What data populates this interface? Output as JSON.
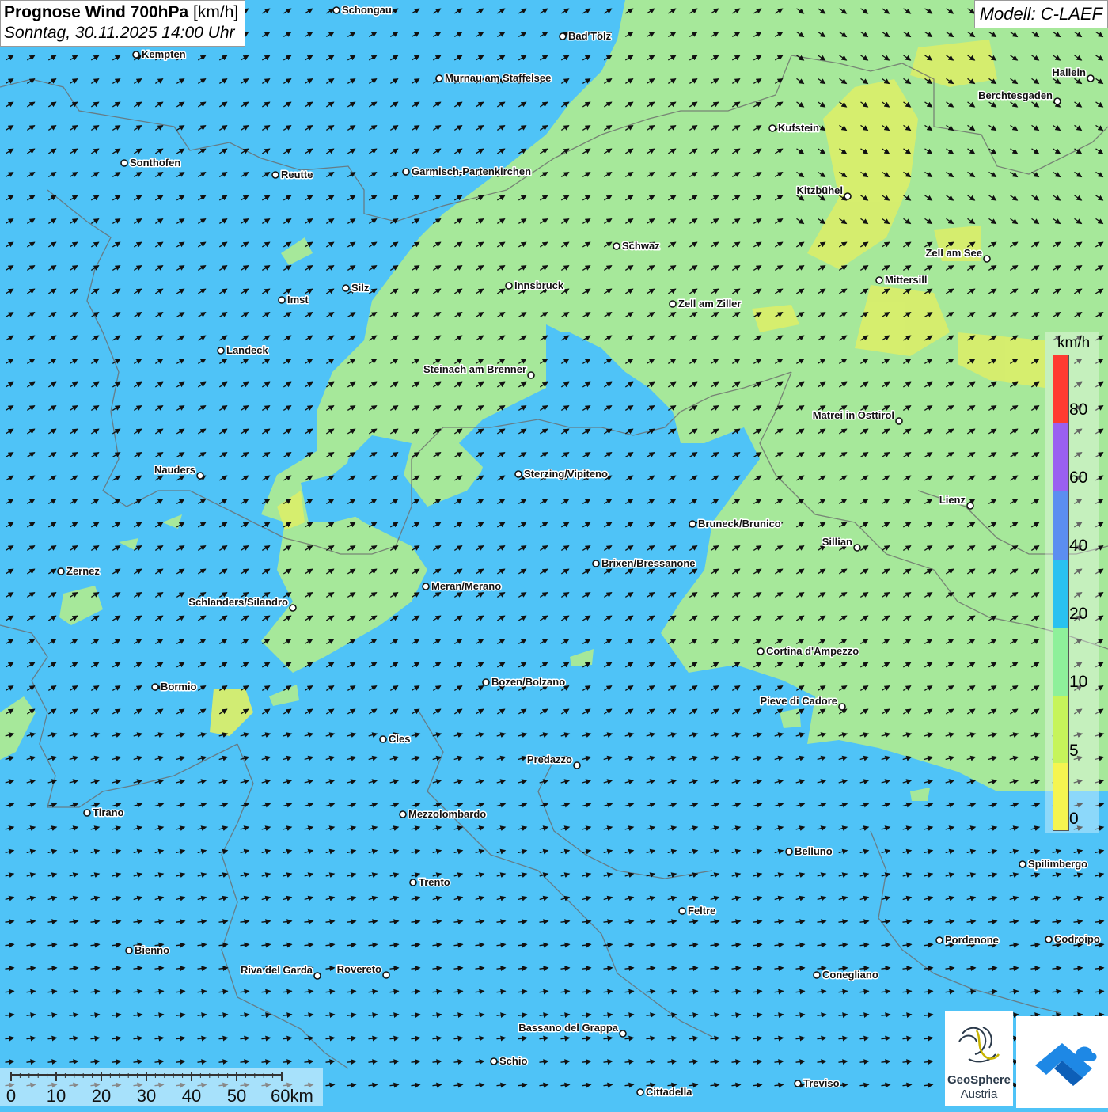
{
  "title": {
    "main": "Prognose Wind 700hPa",
    "unit": "[km/h]",
    "subtitle": "Sonntag, 30.11.2025 14:00 Uhr"
  },
  "model": "Modell: C-LAEF",
  "legend": {
    "unit": "km/h",
    "labels": [
      "80",
      "60",
      "40",
      "20",
      "10",
      "5",
      "0"
    ],
    "segments": [
      {
        "color": "#ff3b30"
      },
      {
        "color": "#9a60f0"
      },
      {
        "color": "#5b8ef0"
      },
      {
        "color": "#29c2f0"
      },
      {
        "color": "#8ef09a"
      },
      {
        "color": "#c6f45a"
      },
      {
        "color": "#f5f550"
      }
    ]
  },
  "scalebar": {
    "ticks": [
      "0",
      "10",
      "20",
      "30",
      "40",
      "50",
      "60km"
    ]
  },
  "logo": {
    "line1": "GeoSphere",
    "line2": "Austria"
  },
  "colors": {
    "calm_band": "#a6e89a",
    "lowest_band": "#d8ee6c",
    "mid_band": "#4fc3f7"
  },
  "cities": [
    {
      "name": "Schongau"
    },
    {
      "name": "Bad Tölz"
    },
    {
      "name": "Kempten"
    },
    {
      "name": "Hallein"
    },
    {
      "name": "Murnau am Staffelsee"
    },
    {
      "name": "Berchtesgaden"
    },
    {
      "name": "Kufstein"
    },
    {
      "name": "Sonthofen"
    },
    {
      "name": "Reutte"
    },
    {
      "name": "Garmisch-Partenkirchen"
    },
    {
      "name": "Kitzbühel"
    },
    {
      "name": "Schwaz"
    },
    {
      "name": "Zell am See"
    },
    {
      "name": "Mittersill"
    },
    {
      "name": "Innsbruck"
    },
    {
      "name": "Silz"
    },
    {
      "name": "Imst"
    },
    {
      "name": "Zell am Ziller"
    },
    {
      "name": "Landeck"
    },
    {
      "name": "Steinach am Brenner"
    },
    {
      "name": "Matrei in Osttirol"
    },
    {
      "name": "Nauders"
    },
    {
      "name": "Sterzing/Vipiteno"
    },
    {
      "name": "Lienz"
    },
    {
      "name": "Bruneck/Brunico"
    },
    {
      "name": "Sillian"
    },
    {
      "name": "Brixen/Bressanone"
    },
    {
      "name": "Zernez"
    },
    {
      "name": "Meran/Merano"
    },
    {
      "name": "Schlanders/Silandro"
    },
    {
      "name": "Cortina d'Ampezzo"
    },
    {
      "name": "Bozen/Bolzano"
    },
    {
      "name": "Bormio"
    },
    {
      "name": "Pieve di Cadore"
    },
    {
      "name": "Cles"
    },
    {
      "name": "Predazzo"
    },
    {
      "name": "Tirano"
    },
    {
      "name": "Mezzolombardo"
    },
    {
      "name": "Belluno"
    },
    {
      "name": "Spilimbergo"
    },
    {
      "name": "Trento"
    },
    {
      "name": "Feltre"
    },
    {
      "name": "Pordenone"
    },
    {
      "name": "Codroipo"
    },
    {
      "name": "Bienno"
    },
    {
      "name": "Riva del Garda"
    },
    {
      "name": "Rovereto"
    },
    {
      "name": "Conegliano"
    },
    {
      "name": "Bassano del Grappa"
    },
    {
      "name": "Schio"
    },
    {
      "name": "Treviso"
    },
    {
      "name": "Cittadella"
    }
  ]
}
